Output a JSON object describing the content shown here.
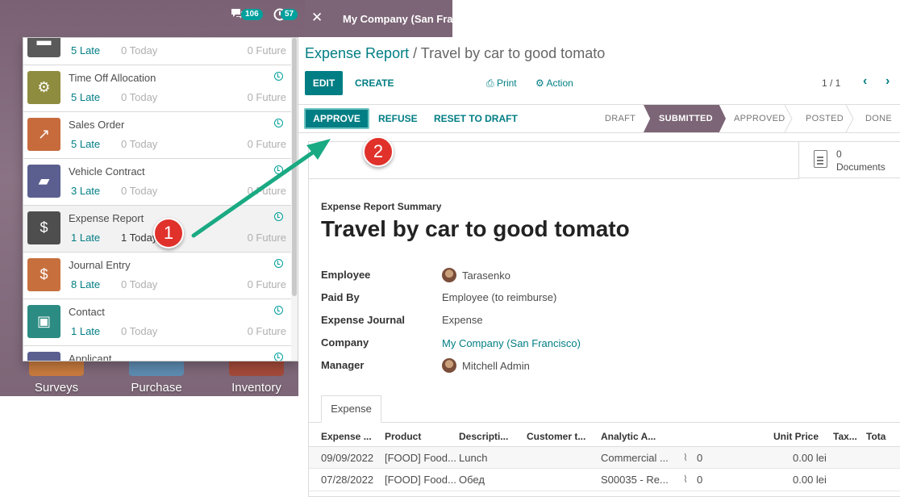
{
  "topbar": {
    "chat_badge": "106",
    "activity_badge": "57",
    "company": "My Company (San Franc"
  },
  "activities": [
    {
      "name": "",
      "late": "5 Late",
      "today": "0 Today",
      "future": "0 Future",
      "icon": "document-icon",
      "color": "#5a5a5a"
    },
    {
      "name": "Time Off Allocation",
      "late": "5 Late",
      "today": "0 Today",
      "future": "0 Future",
      "icon": "user-gear-icon",
      "color": "#8e8c3e"
    },
    {
      "name": "Sales Order",
      "late": "5 Late",
      "today": "0 Today",
      "future": "0 Future",
      "icon": "trend-chart-icon",
      "color": "#c76b3d"
    },
    {
      "name": "Vehicle Contract",
      "late": "3 Late",
      "today": "0 Today",
      "future": "0 Future",
      "icon": "car-icon",
      "color": "#5b5f8f"
    },
    {
      "name": "Expense Report",
      "late": "1 Late",
      "today": "1 Today",
      "future": "0 Future",
      "icon": "user-dollar-icon",
      "color": "#4e4e4e"
    },
    {
      "name": "Journal Entry",
      "late": "8 Late",
      "today": "0 Today",
      "future": "0 Future",
      "icon": "invoice-icon",
      "color": "#c7703e"
    },
    {
      "name": "Contact",
      "late": "1 Late",
      "today": "0 Today",
      "future": "0 Future",
      "icon": "address-book-icon",
      "color": "#2c8b82"
    },
    {
      "name": "Applicant",
      "late": "",
      "today": "",
      "future": "",
      "icon": "target-icon",
      "color": "#5b5f8f"
    }
  ],
  "home_apps": [
    "Surveys",
    "Purchase",
    "Inventory"
  ],
  "breadcrumb": {
    "parent": "Expense Report",
    "separator": " / ",
    "current": "Travel by car to good tomato"
  },
  "control": {
    "edit": "EDIT",
    "create": "CREATE",
    "print": "Print",
    "action": "Action",
    "pager": "1 / 1"
  },
  "statusbar": {
    "approve": "APPROVE",
    "refuse": "REFUSE",
    "reset": "RESET TO DRAFT",
    "stages": [
      "DRAFT",
      "SUBMITTED",
      "APPROVED",
      "POSTED",
      "DONE"
    ],
    "current_stage": "SUBMITTED"
  },
  "smart_button": {
    "count": "0",
    "label": "Documents"
  },
  "summary_label": "Expense Report Summary",
  "title": "Travel by car to good tomato",
  "fields": {
    "employee_label": "Employee",
    "employee": "Tarasenko",
    "paid_by_label": "Paid By",
    "paid_by": "Employee (to reimburse)",
    "journal_label": "Expense Journal",
    "journal": "Expense",
    "company_label": "Company",
    "company": "My Company (San Francisco)",
    "manager_label": "Manager",
    "manager": "Mitchell Admin"
  },
  "tab": "Expense",
  "table": {
    "headers": [
      "Expense ...",
      "Product",
      "Descripti...",
      "Customer t...",
      "Analytic A...",
      "Unit Price",
      "Tax...",
      "Tota"
    ],
    "rows": [
      {
        "date": "09/09/2022",
        "product": "[FOOD] Food...",
        "description": "Lunch",
        "analytic": "Commercial ...",
        "attachments": "0",
        "unit_price": "0.00 lei"
      },
      {
        "date": "07/28/2022",
        "product": "[FOOD] Food...",
        "description": "Обед",
        "analytic": "S00035 - Re...",
        "attachments": "0",
        "unit_price": "0.00 lei"
      }
    ]
  },
  "annotations": {
    "step1": "1",
    "step2": "2",
    "arrow_color": "#1aaa83"
  }
}
